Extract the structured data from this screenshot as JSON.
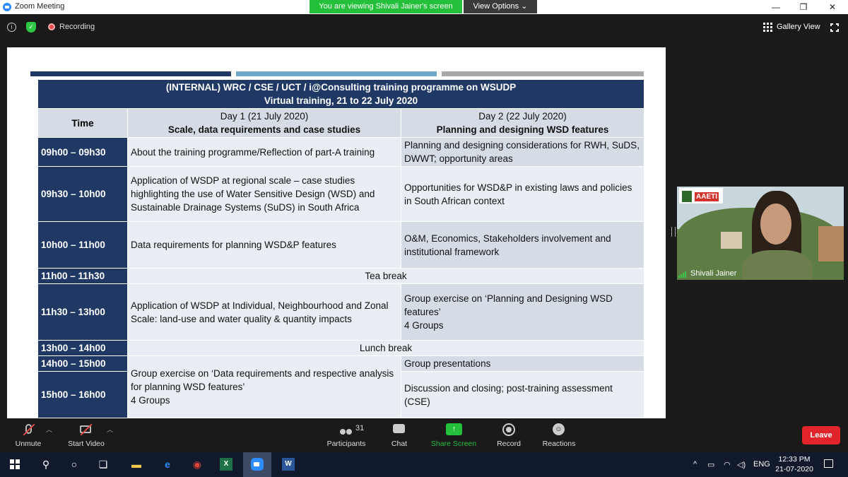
{
  "window": {
    "title": "Zoom Meeting",
    "banner": "You are viewing Shivali Jainer's screen",
    "view_options": "View Options ⌄",
    "minimize": "—",
    "restore": "❐",
    "close": "✕"
  },
  "status_bar": {
    "recording_label": "Recording",
    "gallery_view_label": "Gallery View"
  },
  "slide": {
    "bar_colors": [
      "#1f3864",
      "#6fa8c8",
      "#a8a8a8"
    ],
    "title_line1": "(INTERNAL) WRC / CSE / UCT / i@Consulting training programme on WSUDP",
    "title_line2": "Virtual training, 21 to 22 July 2020",
    "time_header": "Time",
    "day1_header": "Day 1 (21 July 2020)",
    "day1_subheader": "Scale, data requirements and case studies",
    "day2_header": "Day 2 (22 July 2020)",
    "day2_subheader": "Planning and designing WSD features",
    "rows": [
      {
        "time": "09h00 – 09h30",
        "day1": "About the training programme/Reflection of part-A training",
        "day2": "Planning and designing considerations for RWH, SuDS, DWWT; opportunity areas"
      },
      {
        "time": "09h30 – 10h00",
        "day1": "Application of WSDP at regional scale – case studies highlighting the use of Water Sensitive Design (WSD) and Sustainable Drainage Systems (SuDS) in South Africa",
        "day2": "Opportunities for WSD&P in existing laws and policies in South African context"
      },
      {
        "time": "10h00 – 11h00",
        "day1": "Data requirements for planning WSD&P features",
        "day2": "O&M, Economics, Stakeholders involvement and institutional framework"
      },
      {
        "time": "11h00 – 11h30",
        "break": "Tea break"
      },
      {
        "time": "11h30 – 13h00",
        "day1": "Application of WSDP at Individual, Neighbourhood and Zonal Scale: land-use and water quality & quantity impacts",
        "day2": "Group exercise on ‘Planning and Designing WSD features’",
        "day2_extra": "4 Groups"
      },
      {
        "time": "13h00 – 14h00",
        "break": "Lunch break"
      },
      {
        "time": "14h00 – 15h00",
        "day2": "Group presentations"
      },
      {
        "time": "15h00 – 16h00",
        "day1": "Group exercise on ‘Data requirements and respective analysis for planning WSD features’",
        "day1_extra": "4 Groups",
        "day2": "Discussion and closing; post-training assessment (CSE)"
      }
    ]
  },
  "video": {
    "participant_name": "Shivali Jainer",
    "logo_text": "AAETI"
  },
  "toolbar": {
    "unmute": "Unmute",
    "start_video": "Start Video",
    "participants": "Participants",
    "participants_count": "31",
    "chat": "Chat",
    "share_screen": "Share Screen",
    "record": "Record",
    "reactions": "Reactions",
    "leave": "Leave",
    "accent": "#25c03b",
    "leave_color": "#e0242a"
  },
  "taskbar": {
    "language": "ENG",
    "time": "12:33 PM",
    "date": "21-07-2020"
  }
}
